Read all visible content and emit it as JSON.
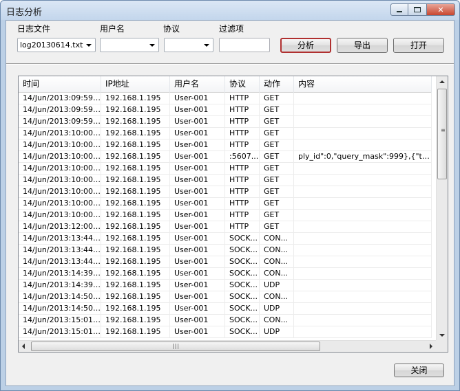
{
  "window": {
    "title": "日志分析"
  },
  "filters": {
    "log_file_label": "日志文件",
    "log_file_value": "log20130614.txt",
    "username_label": "用户名",
    "username_value": "",
    "protocol_label": "协议",
    "protocol_value": "",
    "filter_label": "过滤项",
    "filter_value": ""
  },
  "buttons": {
    "analyze": "分析",
    "export": "导出",
    "open": "打开",
    "close": "关闭"
  },
  "table": {
    "columns": [
      "时间",
      "IP地址",
      "用户名",
      "协议",
      "动作",
      "内容"
    ],
    "rows": [
      [
        "14/Jun/2013:09:59:3...",
        "192.168.1.195",
        "User-001",
        "HTTP",
        "GET",
        ""
      ],
      [
        "14/Jun/2013:09:59:5...",
        "192.168.1.195",
        "User-001",
        "HTTP",
        "GET",
        ""
      ],
      [
        "14/Jun/2013:09:59:5...",
        "192.168.1.195",
        "User-001",
        "HTTP",
        "GET",
        ""
      ],
      [
        "14/Jun/2013:10:00:0...",
        "192.168.1.195",
        "User-001",
        "HTTP",
        "GET",
        ""
      ],
      [
        "14/Jun/2013:10:00:0...",
        "192.168.1.195",
        "User-001",
        "HTTP",
        "GET",
        ""
      ],
      [
        "14/Jun/2013:10:00:0...",
        "192.168.1.195",
        "User-001",
        ":5607...",
        "GET",
        "ply_id\":0,\"query_mask\":999},{\"thread..."
      ],
      [
        "14/Jun/2013:10:00:0...",
        "192.168.1.195",
        "User-001",
        "HTTP",
        "GET",
        ""
      ],
      [
        "14/Jun/2013:10:00:0...",
        "192.168.1.195",
        "User-001",
        "HTTP",
        "GET",
        ""
      ],
      [
        "14/Jun/2013:10:00:0...",
        "192.168.1.195",
        "User-001",
        "HTTP",
        "GET",
        ""
      ],
      [
        "14/Jun/2013:10:00:0...",
        "192.168.1.195",
        "User-001",
        "HTTP",
        "GET",
        ""
      ],
      [
        "14/Jun/2013:10:00:0...",
        "192.168.1.195",
        "User-001",
        "HTTP",
        "GET",
        ""
      ],
      [
        "14/Jun/2013:12:00:1...",
        "192.168.1.195",
        "User-001",
        "HTTP",
        "GET",
        ""
      ],
      [
        "14/Jun/2013:13:44:2...",
        "192.168.1.195",
        "User-001",
        "SOCK...",
        "CON...",
        ""
      ],
      [
        "14/Jun/2013:13:44:2...",
        "192.168.1.195",
        "User-001",
        "SOCK...",
        "CON...",
        ""
      ],
      [
        "14/Jun/2013:13:44:2...",
        "192.168.1.195",
        "User-001",
        "SOCK...",
        "CON...",
        ""
      ],
      [
        "14/Jun/2013:14:39:3...",
        "192.168.1.195",
        "User-001",
        "SOCK...",
        "CON...",
        ""
      ],
      [
        "14/Jun/2013:14:39:3...",
        "192.168.1.195",
        "User-001",
        "SOCK...",
        "UDP",
        ""
      ],
      [
        "14/Jun/2013:14:50:1...",
        "192.168.1.195",
        "User-001",
        "SOCK...",
        "CON...",
        ""
      ],
      [
        "14/Jun/2013:14:50:1...",
        "192.168.1.195",
        "User-001",
        "SOCK...",
        "UDP",
        ""
      ],
      [
        "14/Jun/2013:15:01:0...",
        "192.168.1.195",
        "User-001",
        "SOCK...",
        "CON...",
        ""
      ],
      [
        "14/Jun/2013:15:01:0...",
        "192.168.1.195",
        "User-001",
        "SOCK...",
        "UDP",
        ""
      ]
    ]
  },
  "icons": {
    "minimize": "minimize-icon",
    "maximize": "maximize-icon",
    "close": "close-icon",
    "dropdown": "chevron-down-icon"
  },
  "colors": {
    "default_button_border": "#b03030",
    "window_frame": "#bcd0e6"
  }
}
